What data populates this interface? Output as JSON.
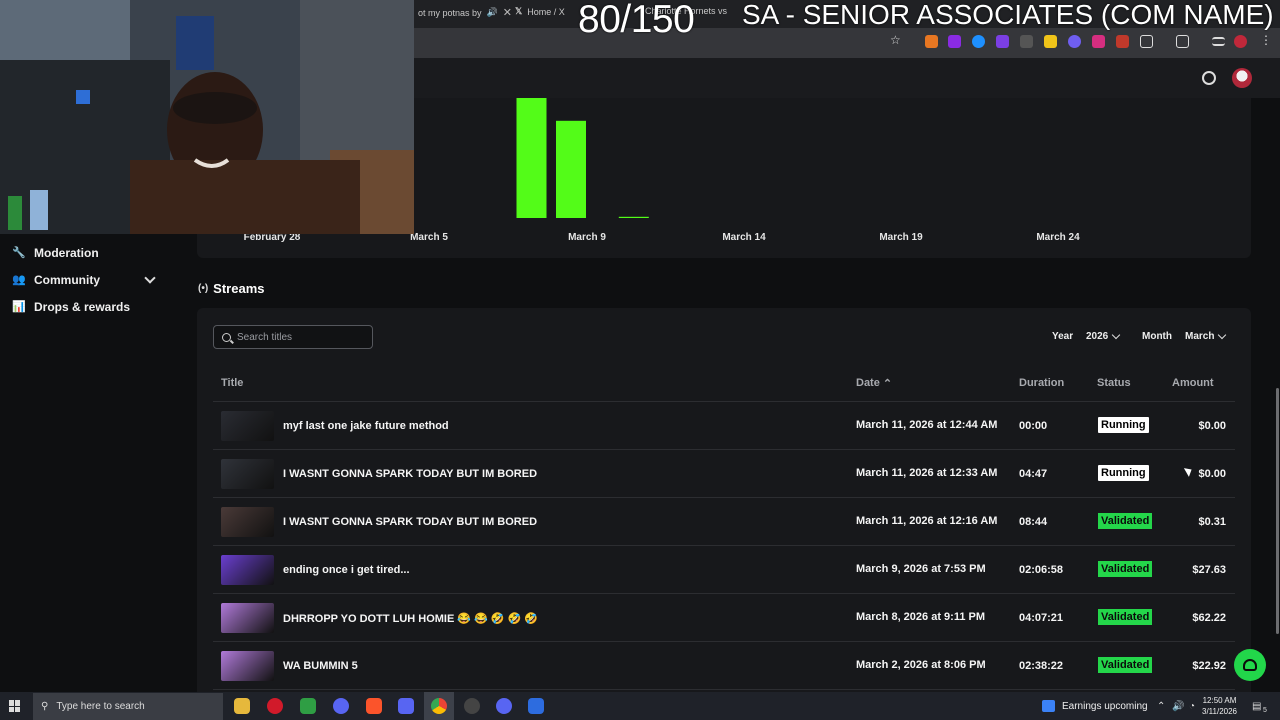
{
  "browser": {
    "tabs": [
      {
        "label": "ot my potnas by"
      },
      {
        "label": "Home / X"
      },
      {
        "label": "Charlotte Hornets vs"
      }
    ]
  },
  "overlay": {
    "counter": "80/150",
    "title": "SA - SENIOR ASSOCIATES (COM NAME)"
  },
  "sidebar": {
    "items": [
      {
        "label": "Moderation",
        "icon": "wrench-icon"
      },
      {
        "label": "Community",
        "icon": "people-icon"
      },
      {
        "label": "Drops & rewards",
        "icon": "chart-icon"
      }
    ]
  },
  "chart_data": {
    "type": "bar",
    "x_tick_labels": [
      "February 28",
      "March 5",
      "March 9",
      "March 14",
      "March 19",
      "March 24"
    ],
    "bar_color": "#53fc18",
    "values_relative": [
      {
        "x": "March 8",
        "value": 1.0
      },
      {
        "x": "March 9",
        "value": 0.81
      },
      {
        "x": "March 11",
        "value": 0.01
      }
    ]
  },
  "streams": {
    "heading": "Streams",
    "search_placeholder": "Search titles",
    "year_label": "Year",
    "year_value": "2026",
    "month_label": "Month",
    "month_value": "March",
    "columns": {
      "title": "Title",
      "date": "Date",
      "duration": "Duration",
      "status": "Status",
      "amount": "Amount"
    },
    "rows": [
      {
        "title": "myf last one jake future method",
        "date": "March 11, 2026 at 12:44 AM",
        "duration": "00:00",
        "status": "Running",
        "amount": "$0.00",
        "thumb": "#2a2c33"
      },
      {
        "title": "I WASNT GONNA SPARK TODAY BUT IM BORED",
        "date": "March 11, 2026 at 12:33 AM",
        "duration": "04:47",
        "status": "Running",
        "amount": "$0.00",
        "thumb": "#30333a"
      },
      {
        "title": "I WASNT GONNA SPARK TODAY BUT IM BORED",
        "date": "March 11, 2026 at 12:16 AM",
        "duration": "08:44",
        "status": "Validated",
        "amount": "$0.31",
        "thumb": "#4a3a38"
      },
      {
        "title": "ending once i get tired...",
        "date": "March 9, 2026 at 7:53 PM",
        "duration": "02:06:58",
        "status": "Validated",
        "amount": "$27.63",
        "thumb": "#6a3fd0"
      },
      {
        "title": "DHRROPP YO DOTT LUH HOMIE 😂 😂 🤣 🤣 🤣",
        "date": "March 8, 2026 at 9:11 PM",
        "duration": "04:07:21",
        "status": "Validated",
        "amount": "$62.22",
        "thumb": "#b07ad9"
      },
      {
        "title": "WA BUMMIN 5",
        "date": "March 2, 2026 at 8:06 PM",
        "duration": "02:38:22",
        "status": "Validated",
        "amount": "$22.92",
        "thumb": "#b07ad9"
      }
    ]
  },
  "taskbar": {
    "search_placeholder": "Type here to search",
    "earnings": "Earnings upcoming",
    "time": "12:50 AM",
    "date": "3/11/2026",
    "notifications": "5"
  },
  "colors": {
    "accent_green": "#53fc18",
    "validated_green": "#24d64a",
    "background": "#0e0f11",
    "card": "#17181b"
  }
}
